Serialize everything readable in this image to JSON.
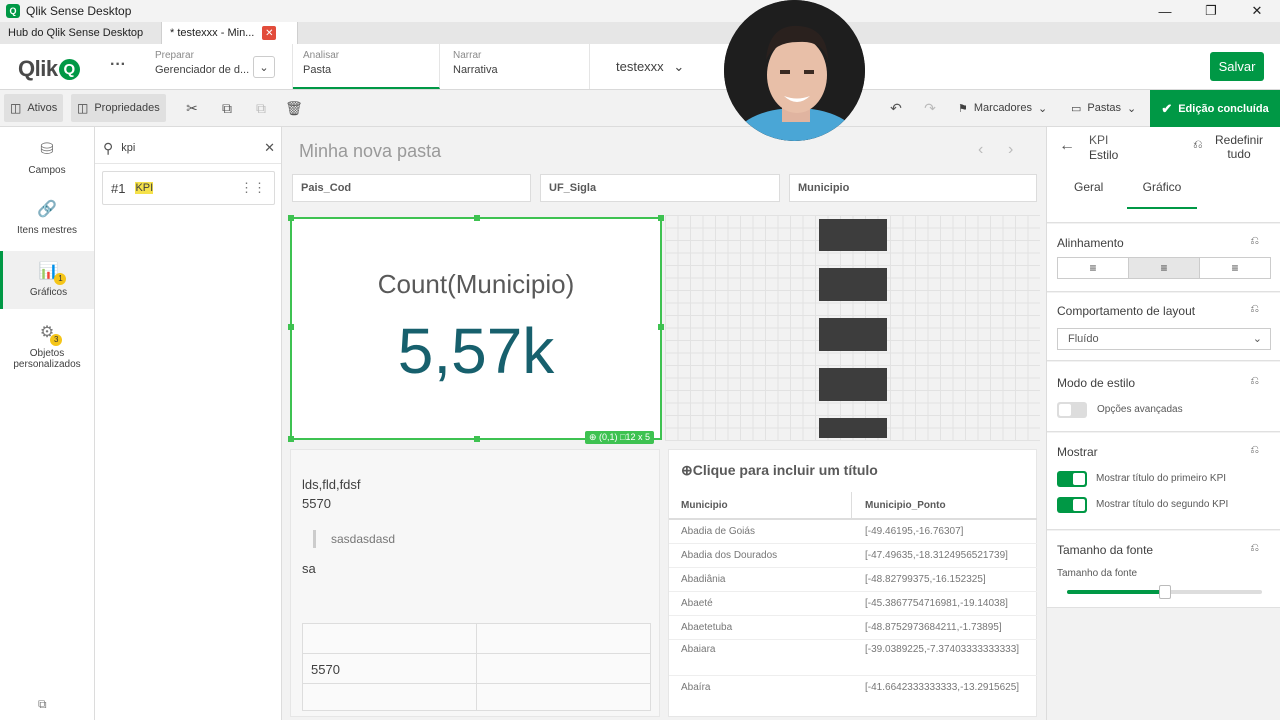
{
  "window": {
    "title": "Qlik Sense Desktop",
    "icon_letter": "Q"
  },
  "tabs": [
    {
      "label": "Hub do Qlik Sense Desktop"
    },
    {
      "label": "* testexxx - Min..."
    }
  ],
  "header": {
    "logo": "Qlik",
    "logo_q": "Q",
    "menu_dots": "···",
    "prepare": {
      "small": "Preparar",
      "big": "Gerenciador de d..."
    },
    "analyze": {
      "small": "Analisar",
      "big": "Pasta"
    },
    "narrate": {
      "small": "Narrar",
      "big": "Narrativa"
    },
    "app_name": "testexxx",
    "save": "Salvar"
  },
  "toolbar": {
    "assets": "Ativos",
    "properties": "Propriedades",
    "bookmarks": "Marcadores",
    "sheets": "Pastas",
    "done": "Edição concluída"
  },
  "leftnav": [
    {
      "label": "Campos"
    },
    {
      "label": "Itens mestres"
    },
    {
      "label": "Gráficos",
      "badge": "1"
    },
    {
      "label": "Objetos personalizados",
      "badge": "3"
    }
  ],
  "assets": {
    "search_value": "kpi",
    "result_prefix": "#1",
    "result_label": "KPI"
  },
  "sheet": {
    "title": "Minha nova pasta",
    "filters": [
      "Pais_Cod",
      "UF_Sigla",
      "Municipio"
    ],
    "kpi": {
      "label": "Count(Municipio)",
      "value": "5,57k",
      "pos": "(0,1)",
      "size": "12 x 5"
    },
    "text": {
      "line1": "lds,fld,fdsf",
      "line2": "5570",
      "quote": "sasdasdasd",
      "line3": "sa",
      "cell": "5570"
    },
    "table": {
      "title": "Clique para incluir um título",
      "headers": [
        "Municipio",
        "Municipio_Ponto"
      ],
      "rows": [
        [
          "Abadia de Goiás",
          "[-49.46195,-16.76307]"
        ],
        [
          "Abadia dos Dourados",
          "[-47.49635,-18.3124956521739]"
        ],
        [
          "Abadiânia",
          "[-48.82799375,-16.152325]"
        ],
        [
          "Abaeté",
          "[-45.3867754716981,-19.14038]"
        ],
        [
          "Abaetetuba",
          "[-48.8752973684211,-1.73895]"
        ],
        [
          "Abaiara",
          "[-39.0389225,-7.37403333333333]"
        ],
        [
          "Abaíra",
          "[-41.6642333333333,-13.2915625]"
        ]
      ]
    }
  },
  "props": {
    "header_kpi": "KPI",
    "header_style": "Estilo",
    "reset_all": "Redefinir tudo",
    "tab_general": "Geral",
    "tab_chart": "Gráfico",
    "alignment": "Alinhamento",
    "layout_behavior": "Comportamento de layout",
    "layout_value": "Fluído",
    "style_mode": "Modo de estilo",
    "advanced": "Opções avançadas",
    "show": "Mostrar",
    "show_first": "Mostrar título do primeiro KPI",
    "show_second": "Mostrar título do segundo KPI",
    "font_size": "Tamanho da fonte",
    "font_size_label": "Tamanho da fonte",
    "font_size_fraction": 0.5
  },
  "colors": {
    "accent": "#009845",
    "kpi_value": "#17606d",
    "selection": "#3ec251"
  }
}
